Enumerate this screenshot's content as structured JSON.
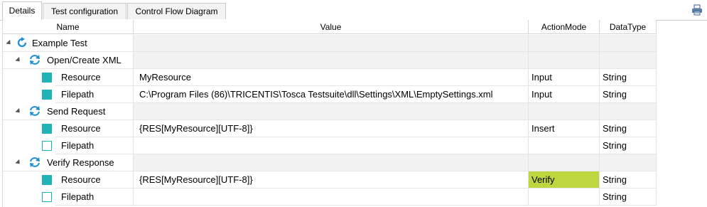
{
  "tabs": [
    {
      "label": "Details",
      "active": true
    },
    {
      "label": "Test configuration",
      "active": false
    },
    {
      "label": "Control Flow Diagram",
      "active": false
    }
  ],
  "columns": {
    "name": "Name",
    "value": "Value",
    "action_mode": "ActionMode",
    "data_type": "DataType"
  },
  "tree": {
    "test_name": "Example Test",
    "modules": [
      {
        "name": "Open/Create XML",
        "params": [
          {
            "name": "Resource",
            "value": "MyResource",
            "action_mode": "Input",
            "data_type": "String",
            "filled": true
          },
          {
            "name": "Filepath",
            "value": "C:\\Program Files (86)\\TRICENTIS\\Tosca Testsuite\\dll\\Settings\\XML\\EmptySettings.xml",
            "action_mode": "Input",
            "data_type": "String",
            "filled": true
          }
        ]
      },
      {
        "name": "Send Request",
        "params": [
          {
            "name": "Resource",
            "value": "{RES[MyResource][UTF-8]}",
            "action_mode": "Insert",
            "data_type": "String",
            "filled": true
          },
          {
            "name": "Filepath",
            "value": "",
            "action_mode": "",
            "data_type": "String",
            "filled": false
          }
        ]
      },
      {
        "name": "Verify Response",
        "params": [
          {
            "name": "Resource",
            "value": "{RES[MyResource][UTF-8]}",
            "action_mode": "Verify",
            "data_type": "String",
            "filled": true
          },
          {
            "name": "Filepath",
            "value": "",
            "action_mode": "",
            "data_type": "String",
            "filled": false
          }
        ]
      }
    ]
  },
  "colors": {
    "accent": "#1fb3b6",
    "verify_highlight": "#bfd73e",
    "refresh_icon": "#1a8fd8"
  },
  "icons": {
    "print": "printer-icon",
    "module": "refresh-icon",
    "expand": "expand-arrow-icon"
  }
}
